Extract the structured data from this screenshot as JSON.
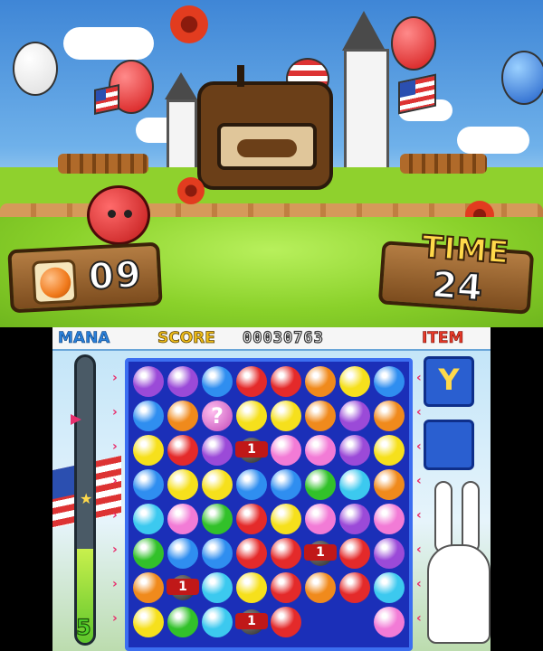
{
  "top_screen": {
    "balls_remaining": "09",
    "time_label": "TIME",
    "time_value": "24"
  },
  "hud": {
    "mana_label": "MANA",
    "score_label": "SCORE",
    "score_value": "00030763",
    "item_label": "ITEM",
    "mana_level": "5",
    "mana_fraction": 0.33
  },
  "items": {
    "slot1_symbol": "Y",
    "slot2_symbol": ""
  },
  "colors": {
    "purple": "#9b4ad8",
    "blue": "#2f8ef0",
    "orange": "#f08a1c",
    "red": "#e42a2a",
    "yellow": "#f6e01c",
    "pink": "#f27bd6",
    "cyan": "#3cc9ef",
    "green": "#32c12a"
  },
  "board": {
    "rows": [
      [
        "purple",
        "purple",
        "blue",
        "red",
        "red",
        "orange",
        "yellow",
        "blue"
      ],
      [
        "blue",
        "orange",
        "mystery",
        "yellow",
        "yellow",
        "orange",
        "purple",
        "orange"
      ],
      [
        "yellow",
        "red",
        "purple",
        "bomb1",
        "pink",
        "pink",
        "purple",
        "yellow"
      ],
      [
        "blue",
        "yellow",
        "yellow",
        "blue",
        "blue",
        "green",
        "cyan",
        "orange"
      ],
      [
        "cyan",
        "pink",
        "green",
        "red",
        "yellow",
        "pink",
        "purple",
        "pink"
      ],
      [
        "green",
        "blue",
        "blue",
        "red",
        "red",
        "bomb1",
        "red",
        "purple"
      ],
      [
        "orange",
        "bomb1",
        "cyan",
        "yellow",
        "red",
        "orange",
        "red",
        "cyan"
      ],
      [
        "yellow",
        "green",
        "cyan",
        "bomb1",
        "red",
        "",
        "",
        "pink"
      ]
    ],
    "bomb_label": "1",
    "mystery_label": "?"
  }
}
